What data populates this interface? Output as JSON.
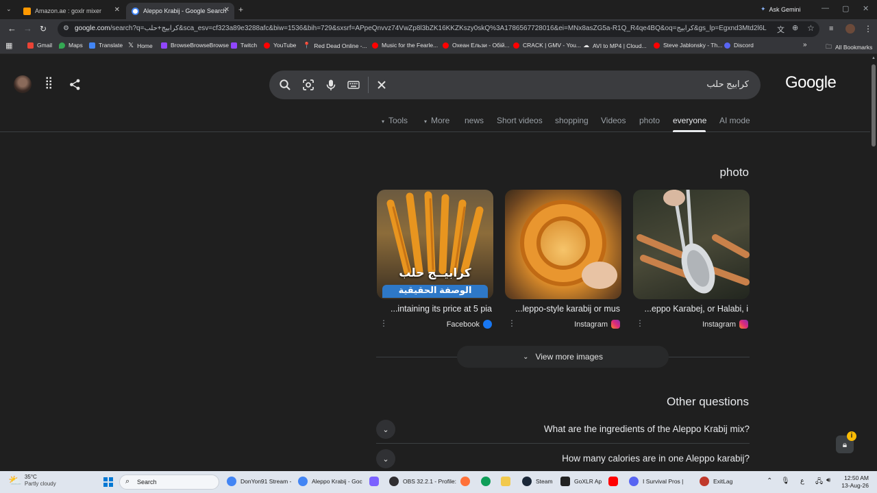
{
  "browser": {
    "tabs": [
      {
        "title": "Amazon.ae : goxlr mixer",
        "active": false,
        "favicon_color": "#f90"
      },
      {
        "title": "Aleppo Krabij - Google Search",
        "active": true,
        "favicon_color": "#4285f4"
      }
    ],
    "new_tab_label": "+",
    "ask_gemini": "Ask Gemini",
    "url_host": "google.com",
    "url_rest": "/search?q=كرابيج+حلب&sca_esv=cf323a89e3288afc&biw=1536&bih=729&sxsrf=APpeQnvvz74VwZp8l3bZK16KKZKszy0skQ%3A1786567728016&ei=MNx8asZG5a-R1Q_R4qe4BQ&oq=كرابيج&gs_lp=Egxnd3Mtd2l6LXNlcnAiCtmD2LHYp..."
  },
  "bookmarks": [
    {
      "label": "Gmail",
      "color": "#ea4335"
    },
    {
      "label": "Maps",
      "color": "#34a853"
    },
    {
      "label": "Translate",
      "color": "#4285f4"
    },
    {
      "label": "Home",
      "color": "#ffffff"
    },
    {
      "label": "BrowseBrowseBrowse",
      "color": "#9146ff"
    },
    {
      "label": "Twitch",
      "color": "#9146ff"
    },
    {
      "label": "YouTube",
      "color": "#ff0000"
    },
    {
      "label": "Red Dead Online -...",
      "color": "#bdbdbd"
    },
    {
      "label": "Music for the Fearle...",
      "color": "#ff0000"
    },
    {
      "label": "Охеан Ельзи - Обій...",
      "color": "#ff0000"
    },
    {
      "label": "CRACK | GMV - You...",
      "color": "#ff0000"
    },
    {
      "label": "AVI to MP4 | Cloud...",
      "color": "#bdbdbd"
    },
    {
      "label": "Steve Jablonsky - Th...",
      "color": "#ff0000"
    },
    {
      "label": "Discord",
      "color": "#5865f2"
    }
  ],
  "all_bookmarks": "All Bookmarks",
  "search": {
    "query": "كرابيج حلب",
    "logo": "Google"
  },
  "search_tabs": [
    {
      "label": "Tools",
      "dropdown": true
    },
    {
      "label": "More",
      "dropdown": true
    },
    {
      "label": "news"
    },
    {
      "label": "Short videos"
    },
    {
      "label": "shopping"
    },
    {
      "label": "Videos"
    },
    {
      "label": "photo"
    },
    {
      "label": "everyone",
      "selected": true
    },
    {
      "label": "AI mode"
    }
  ],
  "images_section": {
    "heading": "photo",
    "cards": [
      {
        "caption": "...intaining its price at 5 pia",
        "source": "Facebook",
        "source_color": "#1877f2",
        "overlay_top": "كرابيــج حلب",
        "overlay_bottom": "الوصفة الحقيقية"
      },
      {
        "caption": "...leppo-style karabij or mus",
        "source": "Instagram",
        "source_color": "#e1306c"
      },
      {
        "caption": "...eppo Karabej, or Halabi, i",
        "source": "Instagram",
        "source_color": "#e1306c"
      }
    ],
    "view_more": "View more images"
  },
  "other_questions": {
    "heading": "Other questions",
    "items": [
      "What are the ingredients of the Aleppo Krabij mix?",
      "How many calories are in one Aleppo karabij?"
    ]
  },
  "taskbar": {
    "weather_temp": "35°C",
    "weather_desc": "Partly cloudy",
    "search_label": "Search",
    "apps": [
      {
        "label": "DonYon91 Stream -",
        "color": "#4285f4"
      },
      {
        "label": "Aleppo Krabij - Goc",
        "color": "#4285f4"
      },
      {
        "label": "",
        "color": "#7b61ff"
      },
      {
        "label": "OBS 32.2.1 - Profile:",
        "color": "#302e31"
      },
      {
        "label": "",
        "color": "#ff7139"
      },
      {
        "label": "",
        "color": "#0f9d58"
      },
      {
        "label": "",
        "color": "#f2c94c"
      },
      {
        "label": "Steam",
        "color": "#1b2838"
      },
      {
        "label": "GoXLR Ap",
        "color": "#222"
      },
      {
        "label": "",
        "color": "#ff0000"
      },
      {
        "label": "I Survival Pros |",
        "color": "#5865f2"
      },
      {
        "label": "ExitLag",
        "color": "#c0392b"
      }
    ],
    "lang": "ع",
    "time": "12:50 AM",
    "date": "13-Aug-26"
  }
}
